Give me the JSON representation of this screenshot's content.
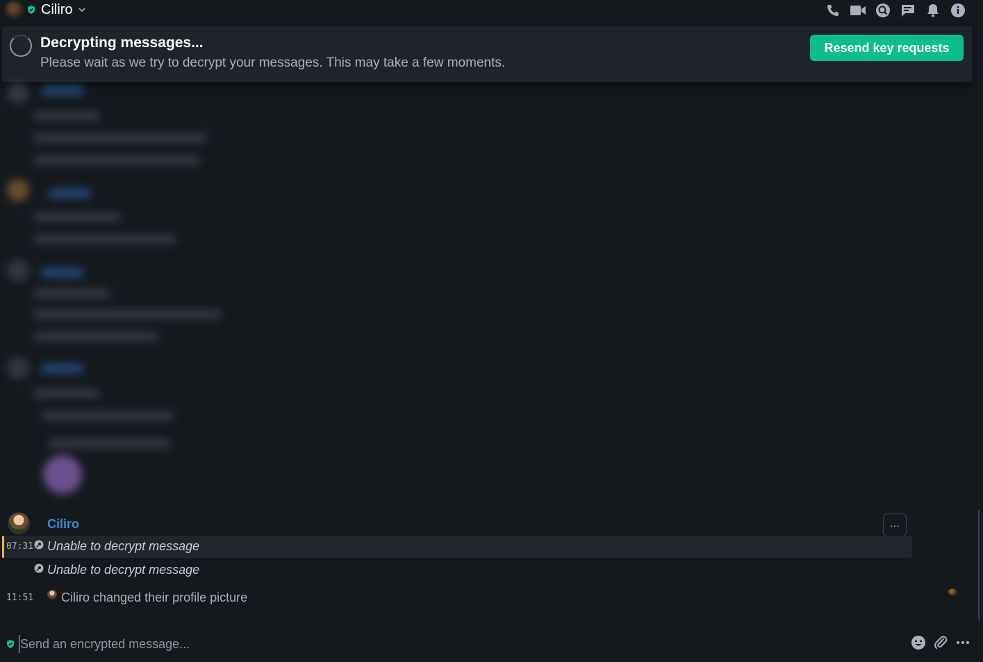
{
  "header": {
    "room_name": "Ciliro",
    "icons": [
      "phone-icon",
      "video-icon",
      "search-icon",
      "threads-icon",
      "bell-icon",
      "info-icon"
    ]
  },
  "banner": {
    "title": "Decrypting messages...",
    "subtitle": "Please wait as we try to decrypt your messages. This may take a few moments.",
    "resend_label": "Resend key requests"
  },
  "timeline": {
    "sender": "Ciliro",
    "options_label": "···",
    "messages": [
      {
        "time": "07:31",
        "text": "Unable to decrypt message"
      },
      {
        "time": "",
        "text": "Unable to decrypt message"
      }
    ],
    "state_event": {
      "time": "11:51",
      "text": "Ciliro changed their profile picture"
    }
  },
  "composer": {
    "placeholder": "Send an encrypted message..."
  },
  "colors": {
    "background": "#15191e",
    "accent": "#0dbd8b",
    "sender": "#368bd6",
    "highlight_bar": "#e8b838"
  }
}
